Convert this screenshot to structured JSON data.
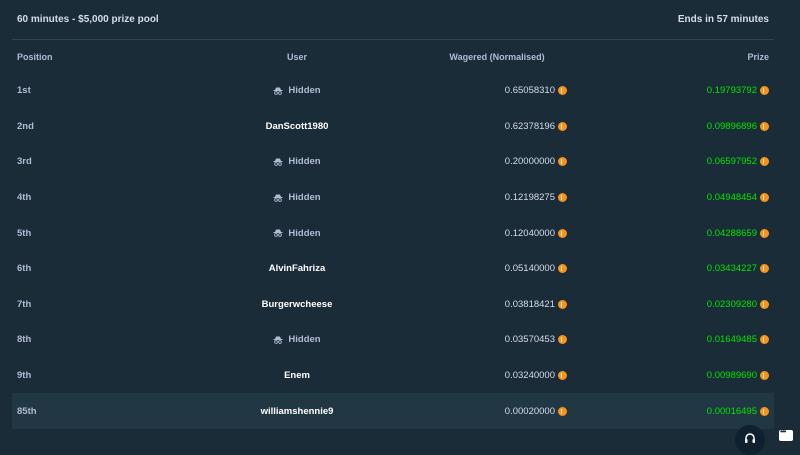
{
  "header": {
    "title": "60 minutes - $5,000 prize pool",
    "ends": "Ends in 57 minutes"
  },
  "columns": {
    "position": "Position",
    "user": "User",
    "wagered": "Wagered (Normalised)",
    "prize": "Prize"
  },
  "rows": [
    {
      "position": "1st",
      "user": "Hidden",
      "hidden": true,
      "wagered": "0.65058310",
      "prize": "0.19793792"
    },
    {
      "position": "2nd",
      "user": "DanScott1980",
      "hidden": false,
      "wagered": "0.62378196",
      "prize": "0.09896896"
    },
    {
      "position": "3rd",
      "user": "Hidden",
      "hidden": true,
      "wagered": "0.20000000",
      "prize": "0.06597952"
    },
    {
      "position": "4th",
      "user": "Hidden",
      "hidden": true,
      "wagered": "0.12198275",
      "prize": "0.04948454"
    },
    {
      "position": "5th",
      "user": "Hidden",
      "hidden": true,
      "wagered": "0.12040000",
      "prize": "0.04288659"
    },
    {
      "position": "6th",
      "user": "AlvinFahriza",
      "hidden": false,
      "wagered": "0.05140000",
      "prize": "0.03434227"
    },
    {
      "position": "7th",
      "user": "Burgerwcheese",
      "hidden": false,
      "wagered": "0.03818421",
      "prize": "0.02309280"
    },
    {
      "position": "8th",
      "user": "Hidden",
      "hidden": true,
      "wagered": "0.03570453",
      "prize": "0.01649485"
    },
    {
      "position": "9th",
      "user": "Enem",
      "hidden": false,
      "wagered": "0.03240000",
      "prize": "0.00989690"
    },
    {
      "position": "85th",
      "user": "williamshennie9",
      "hidden": false,
      "wagered": "0.00020000",
      "prize": "0.00016495"
    }
  ],
  "icons": {
    "currency": "bitcoin-coin-icon",
    "hidden_user": "incognito-icon",
    "support": "headset-icon",
    "chat": "chat-icon"
  },
  "colors": {
    "background": "#1a2c38",
    "highlight_row": "#213743",
    "prize_green": "#00e701",
    "coin": "#f7931a"
  }
}
